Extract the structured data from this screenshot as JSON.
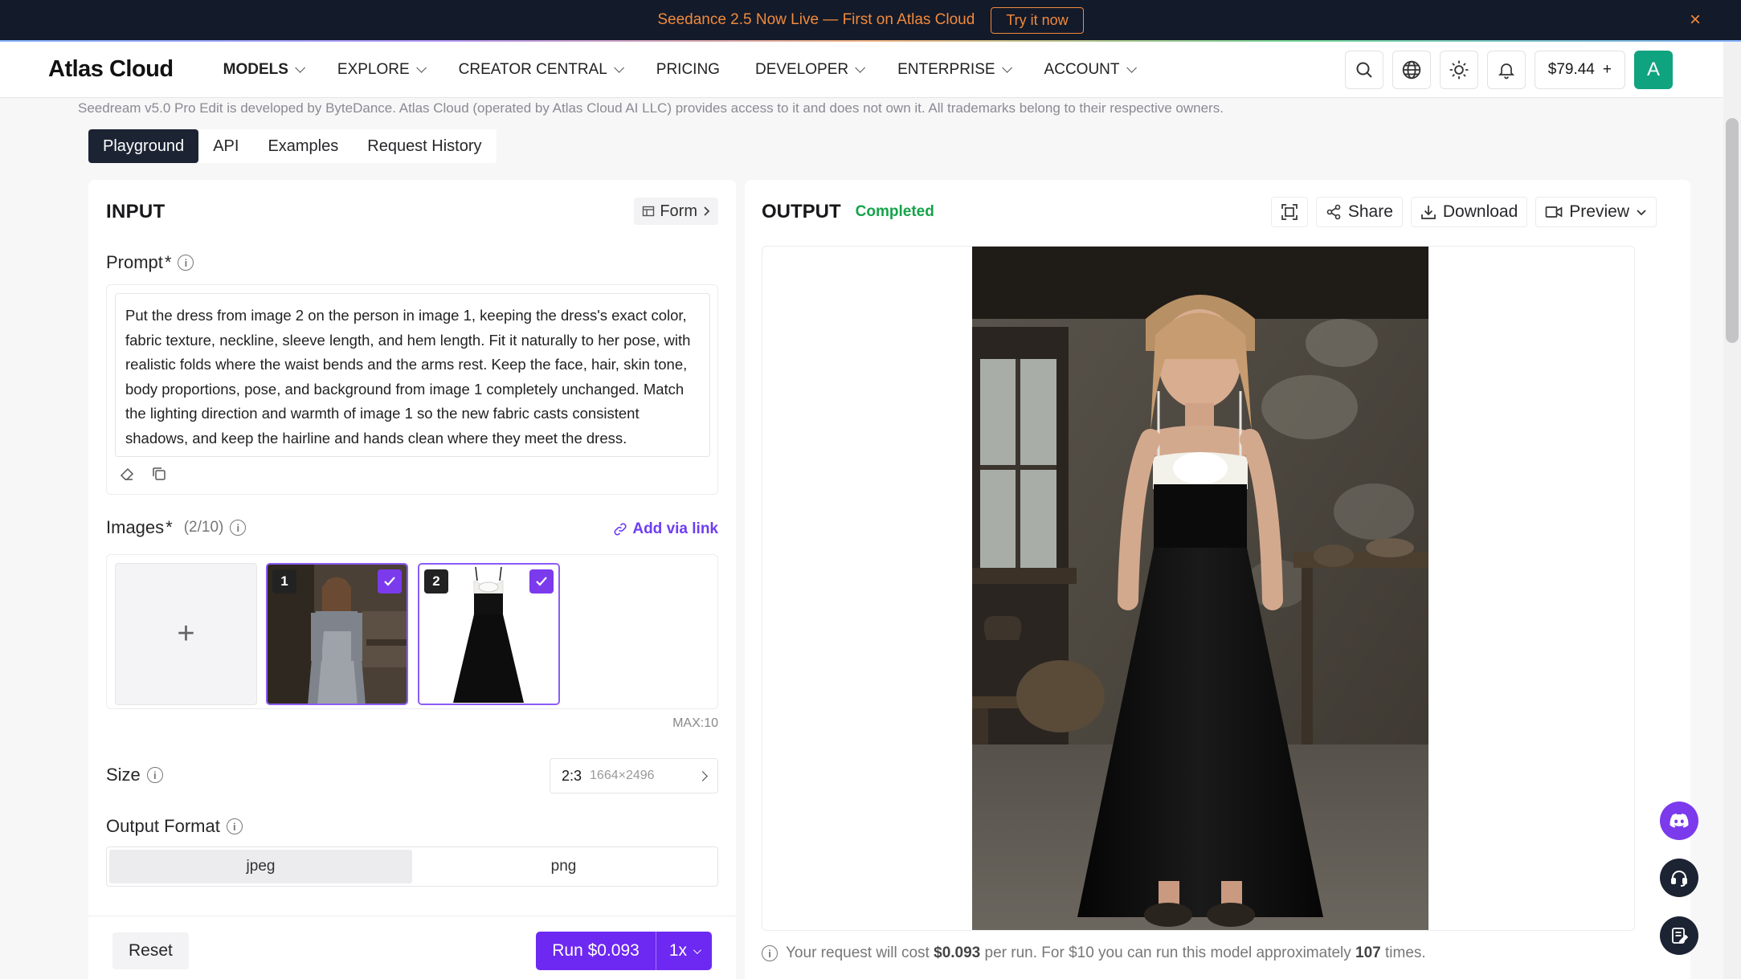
{
  "banner": {
    "text": "Seedance 2.5 Now Live — First on Atlas Cloud",
    "cta": "Try it now",
    "close": "×"
  },
  "nav": {
    "logo": "Atlas Cloud",
    "items": [
      {
        "label": "MODELS",
        "dropdown": true
      },
      {
        "label": "EXPLORE",
        "dropdown": true
      },
      {
        "label": "CREATOR CENTRAL",
        "dropdown": true
      },
      {
        "label": "PRICING",
        "dropdown": false
      },
      {
        "label": "DEVELOPER",
        "dropdown": true
      },
      {
        "label": "ENTERPRISE",
        "dropdown": true
      },
      {
        "label": "ACCOUNT",
        "dropdown": true
      }
    ],
    "balance": "$79.44",
    "balance_add": "+",
    "avatar_letter": "A"
  },
  "disclaimer": "Seedream v5.0 Pro Edit is developed by ByteDance. Atlas Cloud (operated by Atlas Cloud AI LLC) provides access to it and does not own it. All trademarks belong to their respective owners.",
  "tabs": [
    "Playground",
    "API",
    "Examples",
    "Request History"
  ],
  "input": {
    "title": "INPUT",
    "form_toggle": "Form",
    "prompt_label": "Prompt",
    "required_mark": "*",
    "prompt_value": "Put the dress from image 2 on the person in image 1, keeping the dress's exact color, fabric texture, neckline, sleeve length, and hem length. Fit it naturally to her pose, with realistic folds where the waist bends and the arms rest. Keep the face, hair, skin tone, body proportions, pose, and background from image 1 completely unchanged. Match the lighting direction and warmth of image 1 so the new fabric casts consistent shadows, and keep the hairline and hands clean where they meet the dress.",
    "images_label": "Images",
    "images_count": "(2/10)",
    "add_via_link": "Add via link",
    "upload_plus": "+",
    "image_numbers": [
      "1",
      "2"
    ],
    "max_label": "MAX:10",
    "size_label": "Size",
    "size_ratio": "2:3",
    "size_dims": "1664×2496",
    "format_label": "Output Format",
    "formats": [
      "jpeg",
      "png"
    ],
    "selected_format": "jpeg"
  },
  "actions": {
    "reset": "Reset",
    "run": "Run $0.093",
    "multiplier": "1x"
  },
  "output": {
    "title": "OUTPUT",
    "status": "Completed",
    "share": "Share",
    "download": "Download",
    "preview": "Preview",
    "cost_prefix": "Your request will cost",
    "cost_value": "$0.093",
    "cost_mid": "per run. For $10 you can run this model approximately",
    "cost_count": "107",
    "cost_suffix": "times."
  },
  "colors": {
    "accent": "#6d28f2",
    "success": "#16a34a",
    "banner_bg": "#131a2a",
    "banner_text": "#f08a3c",
    "avatar": "#10a37f"
  }
}
